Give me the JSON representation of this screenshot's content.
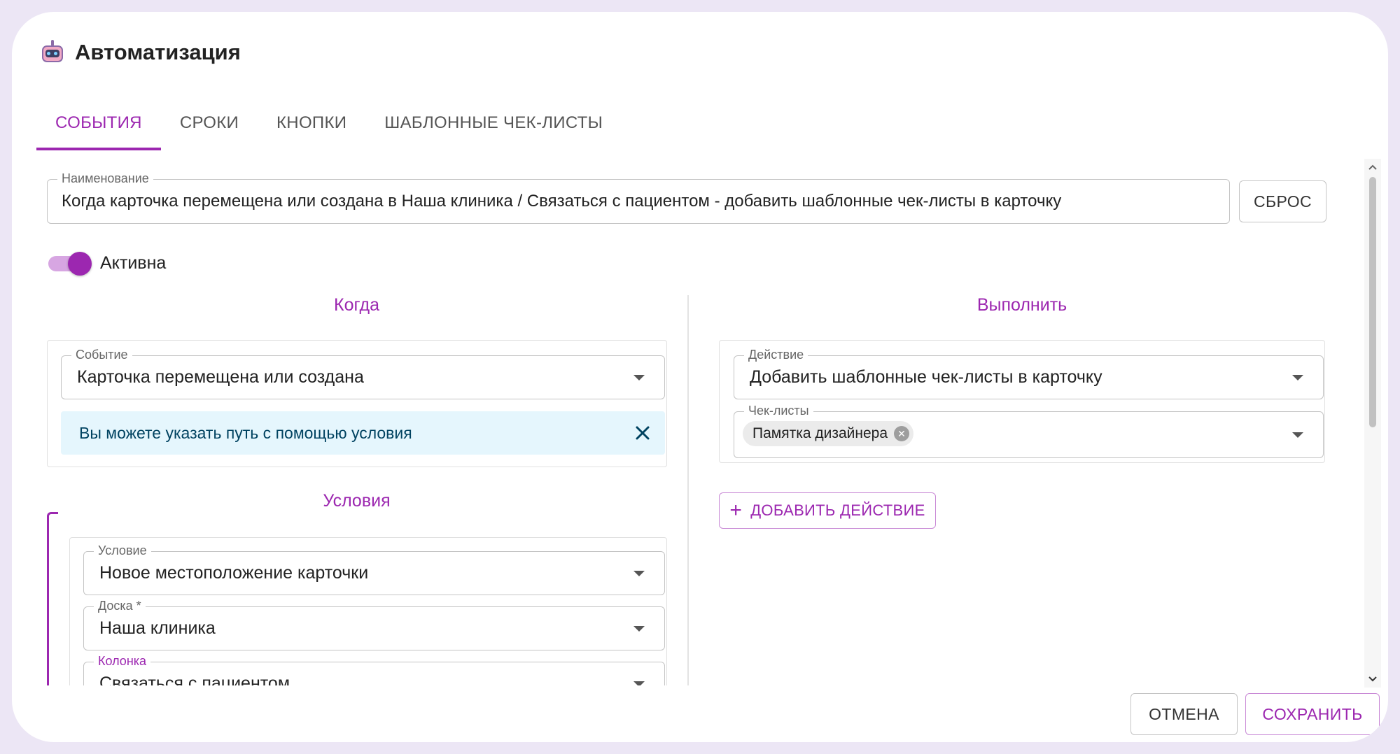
{
  "dialog": {
    "title": "Автоматизация",
    "icon": "robot-icon"
  },
  "tabs": [
    {
      "label": "СОБЫТИЯ",
      "active": true
    },
    {
      "label": "СРОКИ",
      "active": false
    },
    {
      "label": "КНОПКИ",
      "active": false
    },
    {
      "label": "ШАБЛОННЫЕ ЧЕК-ЛИСТЫ",
      "active": false
    }
  ],
  "name_field": {
    "label": "Наименование",
    "value": "Когда карточка перемещена или создана в Наша клиника / Связаться с пациентом - добавить шаблонные чек-листы в карточку"
  },
  "reset_label": "СБРОС",
  "active_toggle": {
    "label": "Активна",
    "on": true
  },
  "when": {
    "title": "Когда",
    "event_field": {
      "label": "Событие",
      "value": "Карточка перемещена или создана"
    },
    "alert": "Вы можете указать путь с помощью условия"
  },
  "conditions": {
    "title": "Условия",
    "condition_field": {
      "label": "Условие",
      "value": "Новое местоположение карточки"
    },
    "board_field": {
      "label": "Доска *",
      "value": "Наша клиника"
    },
    "column_field": {
      "label": "Колонка",
      "value": "Связаться с пациентом"
    }
  },
  "execute": {
    "title": "Выполнить",
    "action_field": {
      "label": "Действие",
      "value": "Добавить шаблонные чек-листы в карточку"
    },
    "checklists_field": {
      "label": "Чек-листы",
      "chips": [
        "Памятка дизайнера"
      ]
    },
    "add_action_label": "ДОБАВИТЬ ДЕЙСТВИЕ"
  },
  "footer": {
    "cancel_label": "ОТМЕНА",
    "save_label": "СОХРАНИТЬ"
  },
  "colors": {
    "accent": "#9c27b0",
    "alert_bg": "#e5f6fd",
    "alert_text": "#014361"
  }
}
